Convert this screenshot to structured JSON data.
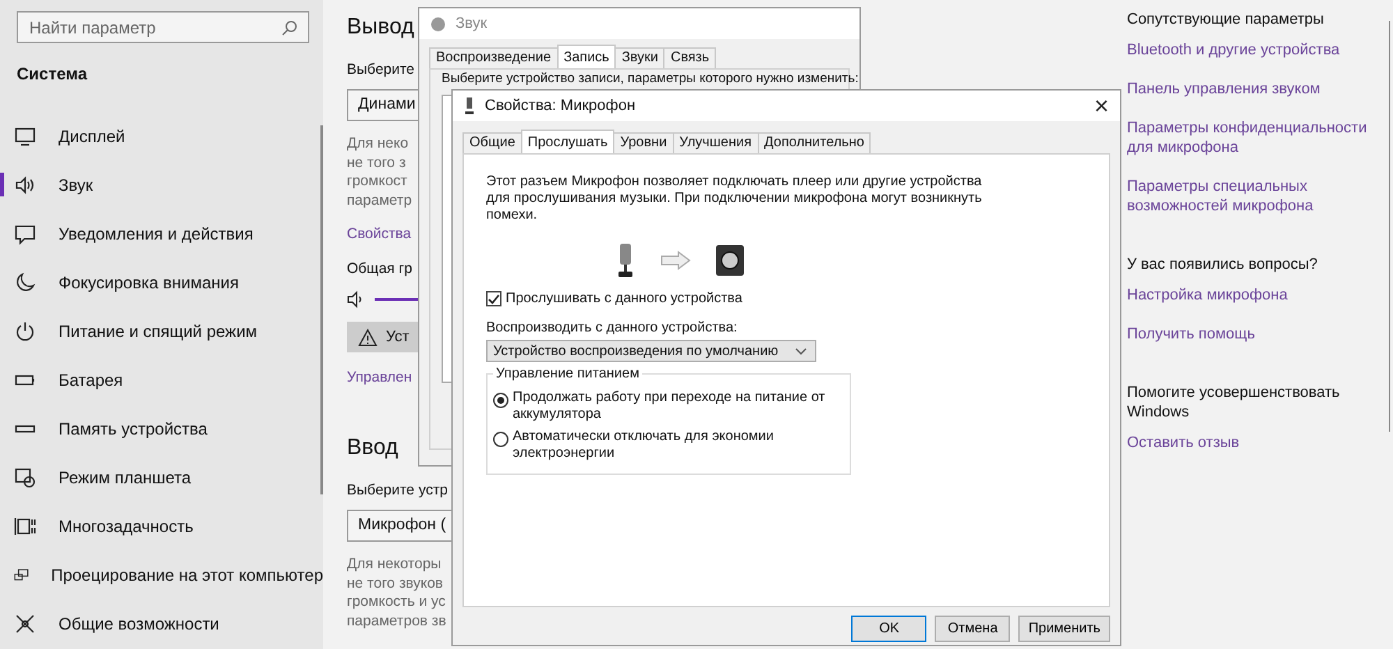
{
  "search": {
    "placeholder": "Найти параметр"
  },
  "sidebar": {
    "heading": "Система",
    "items": [
      {
        "label": "Дисплей",
        "kind": "display",
        "selected": false
      },
      {
        "label": "Звук",
        "kind": "sound",
        "selected": true
      },
      {
        "label": "Уведомления и действия",
        "kind": "notifications",
        "selected": false
      },
      {
        "label": "Фокусировка внимания",
        "kind": "moon",
        "selected": false
      },
      {
        "label": "Питание и спящий режим",
        "kind": "power",
        "selected": false
      },
      {
        "label": "Батарея",
        "kind": "battery",
        "selected": false
      },
      {
        "label": "Память устройства",
        "kind": "storage",
        "selected": false
      },
      {
        "label": "Режим планшета",
        "kind": "tablet",
        "selected": false
      },
      {
        "label": "Многозадачность",
        "kind": "multitask",
        "selected": false
      },
      {
        "label": "Проецирование на этот компьютер",
        "kind": "project",
        "selected": false
      },
      {
        "label": "Общие возможности",
        "kind": "access",
        "selected": false
      }
    ]
  },
  "output": {
    "heading": "Вывод",
    "choose_label": "Выберите",
    "device": "Динами",
    "note_lines": [
      "Для неко",
      "не того з",
      "громкост",
      "параметр"
    ],
    "properties_link": "Свойства",
    "volume_label": "Общая гр",
    "troubleshoot_button": "Уст",
    "manage_link": "Управлен"
  },
  "input": {
    "heading": "Ввод",
    "choose_label": "Выберите устр",
    "device": "Микрофон (",
    "note_lines": [
      "Для некоторы",
      "не того звуков",
      "громкость и ус",
      "параметров зв"
    ]
  },
  "related": {
    "heading": "Сопутствующие параметры",
    "links": [
      "Bluetooth и другие устройства",
      "Панель управления звуком",
      "Параметры конфиденциальности для микрофона",
      "Параметры специальных возможностей микрофона"
    ]
  },
  "questions": {
    "heading": "У вас появились вопросы?",
    "links": [
      "Настройка микрофона",
      "Получить помощь"
    ]
  },
  "improve": {
    "heading": "Помогите усовершенствовать Windows",
    "links": [
      "Оставить отзыв"
    ]
  },
  "sound_window": {
    "title": "Звук",
    "tabs": [
      {
        "label": "Воспроизведение",
        "selected": false
      },
      {
        "label": "Запись",
        "selected": true
      },
      {
        "label": "Звуки",
        "selected": false
      },
      {
        "label": "Связь",
        "selected": false
      }
    ],
    "instruction": "Выберите устройство записи, параметры которого нужно изменить:"
  },
  "properties_window": {
    "title": "Свойства: Микрофон",
    "close": "×",
    "tabs": [
      {
        "label": "Общие",
        "selected": false
      },
      {
        "label": "Прослушать",
        "selected": true
      },
      {
        "label": "Уровни",
        "selected": false
      },
      {
        "label": "Улучшения",
        "selected": false
      },
      {
        "label": "Дополнительно",
        "selected": false
      }
    ],
    "description": "Этот разъем Микрофон позволяет подключать плеер или другие устройства для прослушивания музыки. При подключении микрофона могут возникнуть помехи.",
    "listen": {
      "label": "Прослушивать с данного устройства",
      "checked": true
    },
    "playback_label": "Воспроизводить с данного устройства:",
    "playback_device": "Устройство воспроизведения по умолчанию",
    "power": {
      "title": "Управление питанием",
      "options": [
        {
          "label": "Продолжать работу при переходе на питание от аккумулятора",
          "selected": true
        },
        {
          "label": "Автоматически отключать для экономии электроэнергии",
          "selected": false
        }
      ]
    },
    "buttons": [
      {
        "label": "OK",
        "focused": true
      },
      {
        "label": "Отмена",
        "focused": false
      },
      {
        "label": "Применить",
        "focused": false
      }
    ]
  }
}
